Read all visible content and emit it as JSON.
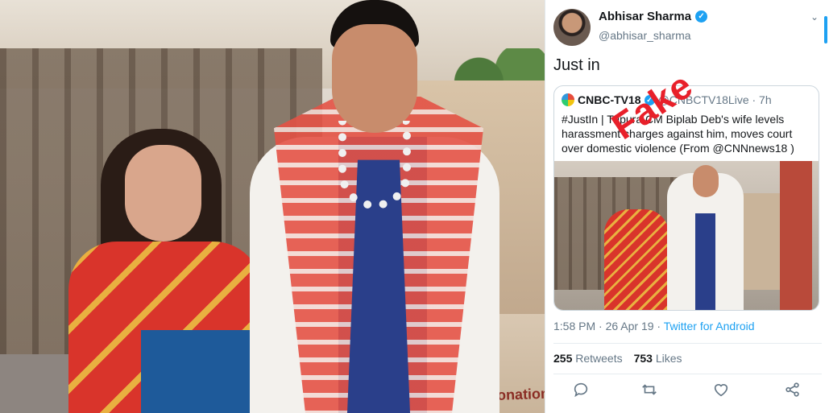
{
  "photo": {
    "donation_box_label": "Donation"
  },
  "tweet": {
    "author_name": "Abhisar Sharma",
    "author_handle": "@abhisar_sharma",
    "text": "Just in",
    "stamp": "Fake",
    "quoted": {
      "name": "CNBC-TV18",
      "handle_time": "@CNBCTV18Live · 7h",
      "text": "#JustIn | Tripura CM Biplab Deb's wife levels harassment charges against him, moves court over domestic violence (From @CNNnews18 )"
    },
    "timestamp": "1:58 PM · 26 Apr 19 · ",
    "client": "Twitter for Android",
    "retweets_count": "255",
    "retweets_label": "Retweets",
    "likes_count": "753",
    "likes_label": "Likes",
    "actions": [
      "reply-icon",
      "retweet-icon",
      "like-icon",
      "share-icon"
    ],
    "colors": {
      "accent": "#1da1f2",
      "stamp": "#e8202a"
    }
  }
}
